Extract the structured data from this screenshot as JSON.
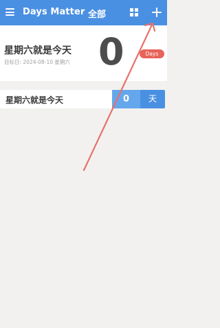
{
  "header": {
    "app_title": "Days Matter",
    "separator": "·",
    "category": "全部",
    "icons": {
      "menu": "menu-icon",
      "view": "grid-view-icon",
      "add": "plus-icon"
    }
  },
  "featured": {
    "title": "星期六就是今天",
    "target_date": "目标日: 2024-08-10 星期六",
    "count": "0",
    "unit_badge": "Days"
  },
  "events": [
    {
      "title": "星期六就是今天",
      "count": "0",
      "unit": "天"
    }
  ],
  "colors": {
    "header": "#4a90e2",
    "badge": "#e8635a",
    "count_cell": "#64a7ec",
    "unit_cell": "#4a90e2",
    "background": "#f2f1f0",
    "annotation_arrow": "#e8706a"
  }
}
